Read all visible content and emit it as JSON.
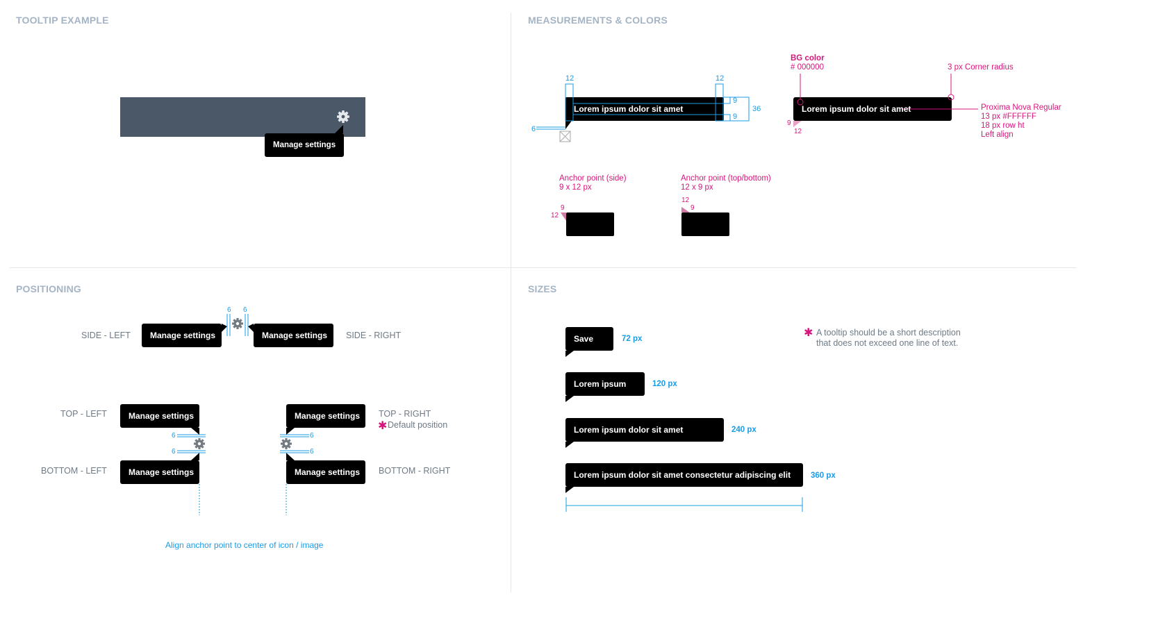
{
  "sections": {
    "tooltip_example": "TOOLTIP EXAMPLE",
    "measurements": "MEASUREMENTS & COLORS",
    "positioning": "POSITIONING",
    "sizes": "SIZES"
  },
  "example": {
    "tooltip": "Manage settings",
    "bar_color": "#4a5868"
  },
  "measurements": {
    "sample_text": "Lorem ipsum dolor sit amet",
    "dim_12a": "12",
    "dim_12b": "12",
    "dim_9a": "9",
    "dim_9b": "9",
    "dim_36": "36",
    "dim_6": "6",
    "bg_label": "BG color",
    "bg_value": "# 000000",
    "corner": "3 px Corner radius",
    "font_line1": "Proxima Nova Regular",
    "font_line2": "13 px  #FFFFFF",
    "font_line3": "18 px row ht",
    "font_line4": "Left align",
    "side_9": "9",
    "side_12": "12",
    "anchor_side_title": "Anchor point (side)",
    "anchor_side_size": "9 x 12 px",
    "anchor_side_9": "9",
    "anchor_side_12": "12",
    "anchor_tb_title": "Anchor point (top/bottom)",
    "anchor_tb_size": "12 x 9 px",
    "anchor_tb_12": "12",
    "anchor_tb_9": "9"
  },
  "positioning": {
    "side_left": "SIDE - LEFT",
    "side_right": "SIDE - RIGHT",
    "top_left": "TOP - LEFT",
    "top_right": "TOP - RIGHT",
    "default_position": "Default position",
    "bottom_left": "BOTTOM - LEFT",
    "bottom_right": "BOTTOM - RIGHT",
    "tooltip": "Manage settings",
    "gap_6": "6",
    "align_note": "Align anchor point to center of icon / image"
  },
  "sizes": {
    "items": [
      {
        "text": "Save",
        "size": "72 px"
      },
      {
        "text": "Lorem ipsum",
        "size": "120 px"
      },
      {
        "text": "Lorem ipsum dolor sit amet",
        "size": "240 px"
      },
      {
        "text": "Lorem ipsum dolor sit amet consectetur adipiscing elit",
        "size": "360 px"
      }
    ],
    "note_line1": "A tooltip should be a short description",
    "note_line2": "that does not exceed one line of text."
  },
  "colors": {
    "accent_blue": "#1a9be6",
    "accent_magenta": "#d6157b",
    "tooltip_bg": "#000000",
    "tooltip_text": "#FFFFFF"
  }
}
